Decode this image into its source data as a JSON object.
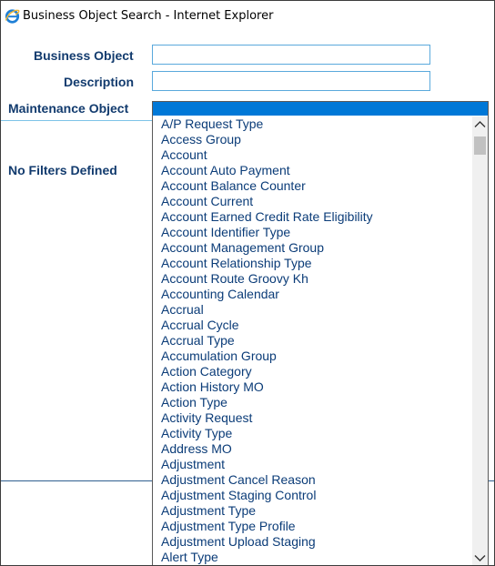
{
  "window": {
    "title": "Business Object Search - Internet Explorer",
    "icon": "internet-explorer-icon"
  },
  "form": {
    "business_object_label": "Business Object",
    "business_object_value": "",
    "description_label": "Description",
    "description_value": "",
    "maintenance_object_label": "Maintenance Object",
    "no_filters_text": "No Filters Defined"
  },
  "dropdown": {
    "selected_value": "",
    "options": [
      "A/P Request Type",
      "Access Group",
      "Account",
      "Account Auto Payment",
      "Account Balance Counter",
      "Account Current",
      "Account Earned Credit Rate Eligibility",
      "Account Identifier Type",
      "Account Management Group",
      "Account Relationship Type",
      "Account Route Groovy Kh",
      "Accounting Calendar",
      "Accrual",
      "Accrual Cycle",
      "Accrual Type",
      "Accumulation Group",
      "Action Category",
      "Action History MO",
      "Action Type",
      "Activity Request",
      "Activity Type",
      "Address MO",
      "Adjustment",
      "Adjustment Cancel Reason",
      "Adjustment Staging Control",
      "Adjustment Type",
      "Adjustment Type Profile",
      "Adjustment Upload Staging",
      "Alert Type"
    ]
  },
  "colors": {
    "label": "#123b6e",
    "option_text": "#0b3c78",
    "selection": "#0078d7",
    "input_border": "#5aa9dc"
  }
}
